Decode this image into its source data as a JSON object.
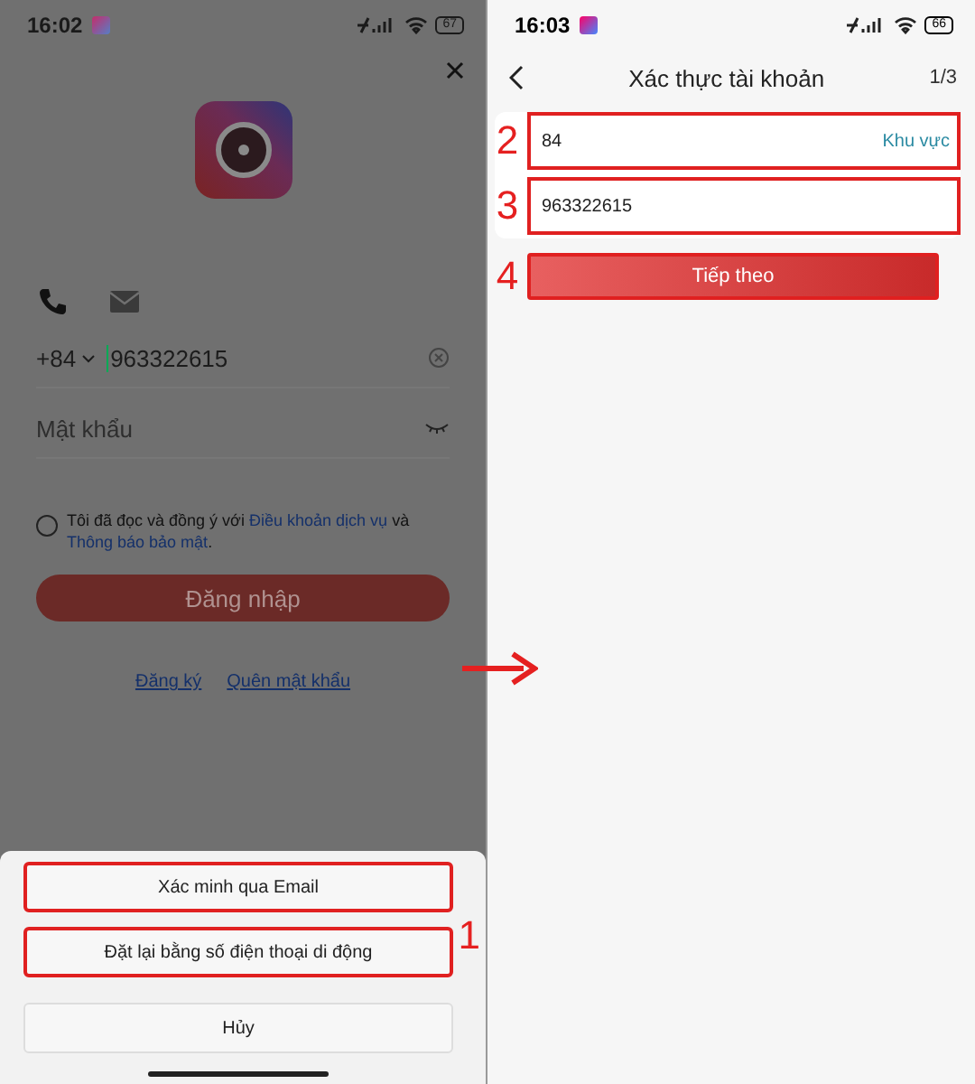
{
  "left_screen": {
    "status_bar": {
      "time": "16:02",
      "battery": "67"
    },
    "login": {
      "method_tabs": [
        {
          "kind": "phone",
          "selected": true
        },
        {
          "kind": "email",
          "selected": false
        }
      ],
      "country_code": "+84",
      "phone": "963322615",
      "password_placeholder": "Mật khẩu",
      "agreement": {
        "checked": false,
        "text": "Tôi đã đọc và đồng ý với",
        "terms_link": "Điều khoản dịch vụ",
        "conjunction": "và",
        "privacy_link": "Thông báo bảo mật",
        "end": "."
      },
      "login_button": "Đăng nhập",
      "links": [
        "Đăng ký",
        "Quên mật khẩu"
      ]
    },
    "action_sheet": {
      "callout": "1",
      "options": [
        {
          "label": "Xác minh qua Email",
          "highlighted": true
        },
        {
          "label": "Đặt lại bằng số điện thoại di động",
          "highlighted": true
        }
      ],
      "cancel": "Hủy"
    }
  },
  "right_screen": {
    "status_bar": {
      "time": "16:03",
      "battery": "66"
    },
    "title": "Xác thực tài khoản",
    "step": "1/3",
    "fields": [
      {
        "value": "84",
        "action": "Khu vực",
        "highlighted": true,
        "callout": "2"
      },
      {
        "value": "963322615",
        "highlighted": true,
        "callout": "3"
      }
    ],
    "next_button": {
      "label": "Tiếp theo",
      "highlighted": true,
      "callout": "4"
    }
  }
}
